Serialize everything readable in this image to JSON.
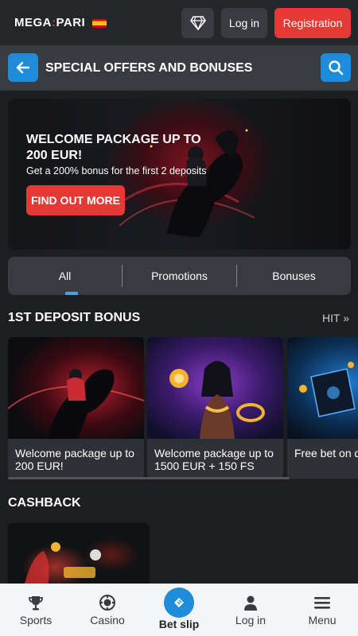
{
  "header": {
    "logo_left": "MEGA",
    "logo_right": "PARI",
    "login_label": "Log in",
    "register_label": "Registration"
  },
  "titlebar": {
    "title": "SPECIAL OFFERS AND BONUSES"
  },
  "hero": {
    "title": "WELCOME PACKAGE UP TO 200 EUR!",
    "subtitle": "Get a 200% bonus for the first 2 deposits",
    "cta": "FIND OUT MORE"
  },
  "tabs": [
    {
      "label": "All",
      "active": true
    },
    {
      "label": "Promotions",
      "active": false
    },
    {
      "label": "Bonuses",
      "active": false
    }
  ],
  "sections": {
    "deposit": {
      "title": "1ST DEPOSIT BONUS",
      "hit_label": "HIT"
    },
    "cashback": {
      "title": "CASHBACK"
    }
  },
  "cards": [
    {
      "text": "Welcome package up to 200 EUR!"
    },
    {
      "text": "Welcome package up to 1500 EUR + 150 FS"
    },
    {
      "text": "Free bet on deposit"
    }
  ],
  "bottom_nav": {
    "sports": "Sports",
    "casino": "Casino",
    "betslip": "Bet slip",
    "login": "Log in",
    "menu": "Menu"
  },
  "colors": {
    "accent_red": "#e53935",
    "accent_blue": "#1e8cd9",
    "background": "#1d1e22",
    "panel": "#3a3b40"
  },
  "icons": [
    "diamond-icon",
    "arrow-left-icon",
    "search-icon",
    "trophy-icon",
    "casino-chip-icon",
    "ticket-icon",
    "user-icon",
    "hamburger-icon",
    "double-chevron-right-icon"
  ]
}
